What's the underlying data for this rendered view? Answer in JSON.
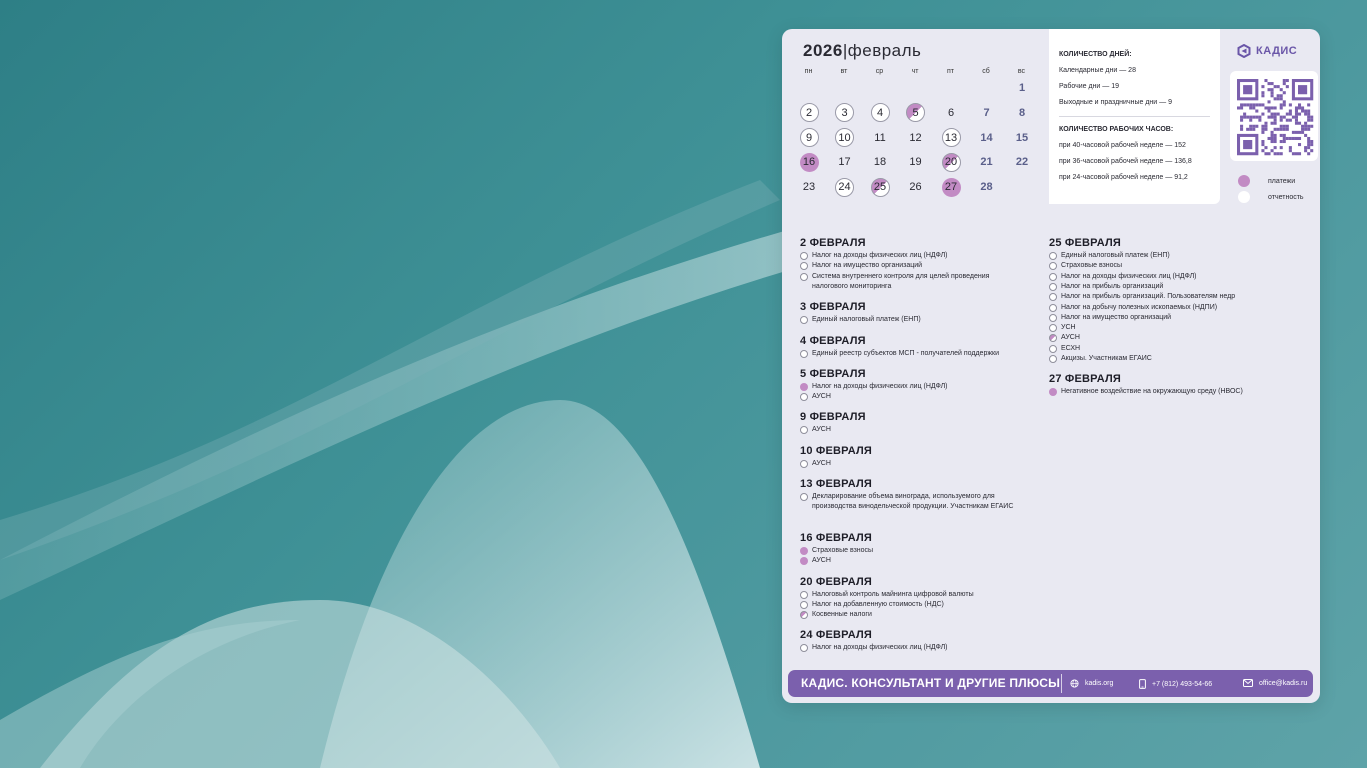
{
  "calendar": {
    "year": "2026",
    "separator": "|",
    "month": "февраль",
    "weekdays": [
      "пн",
      "вт",
      "ср",
      "чт",
      "пт",
      "сб",
      "вс"
    ],
    "days": [
      {
        "d": "1",
        "col": 6,
        "row": 0,
        "kind": "plain",
        "weekend": true
      },
      {
        "d": "2",
        "col": 0,
        "row": 1,
        "kind": "rep"
      },
      {
        "d": "3",
        "col": 1,
        "row": 1,
        "kind": "rep"
      },
      {
        "d": "4",
        "col": 2,
        "row": 1,
        "kind": "rep"
      },
      {
        "d": "5",
        "col": 3,
        "row": 1,
        "kind": "half"
      },
      {
        "d": "6",
        "col": 4,
        "row": 1,
        "kind": "plain"
      },
      {
        "d": "7",
        "col": 5,
        "row": 1,
        "kind": "plain",
        "weekend": true
      },
      {
        "d": "8",
        "col": 6,
        "row": 1,
        "kind": "plain",
        "weekend": true
      },
      {
        "d": "9",
        "col": 0,
        "row": 2,
        "kind": "rep"
      },
      {
        "d": "10",
        "col": 1,
        "row": 2,
        "kind": "rep"
      },
      {
        "d": "11",
        "col": 2,
        "row": 2,
        "kind": "plain"
      },
      {
        "d": "12",
        "col": 3,
        "row": 2,
        "kind": "plain"
      },
      {
        "d": "13",
        "col": 4,
        "row": 2,
        "kind": "rep"
      },
      {
        "d": "14",
        "col": 5,
        "row": 2,
        "kind": "plain",
        "weekend": true
      },
      {
        "d": "15",
        "col": 6,
        "row": 2,
        "kind": "plain",
        "weekend": true
      },
      {
        "d": "16",
        "col": 0,
        "row": 3,
        "kind": "pay"
      },
      {
        "d": "17",
        "col": 1,
        "row": 3,
        "kind": "plain"
      },
      {
        "d": "18",
        "col": 2,
        "row": 3,
        "kind": "plain"
      },
      {
        "d": "19",
        "col": 3,
        "row": 3,
        "kind": "plain"
      },
      {
        "d": "20",
        "col": 4,
        "row": 3,
        "kind": "half"
      },
      {
        "d": "21",
        "col": 5,
        "row": 3,
        "kind": "plain",
        "weekend": true
      },
      {
        "d": "22",
        "col": 6,
        "row": 3,
        "kind": "plain",
        "weekend": true
      },
      {
        "d": "23",
        "col": 0,
        "row": 4,
        "kind": "plain"
      },
      {
        "d": "24",
        "col": 1,
        "row": 4,
        "kind": "rep"
      },
      {
        "d": "25",
        "col": 2,
        "row": 4,
        "kind": "half"
      },
      {
        "d": "26",
        "col": 3,
        "row": 4,
        "kind": "plain"
      },
      {
        "d": "27",
        "col": 4,
        "row": 4,
        "kind": "pay"
      },
      {
        "d": "28",
        "col": 5,
        "row": 4,
        "kind": "plain",
        "weekend": true
      }
    ]
  },
  "stats": {
    "days_title": "КОЛИЧЕСТВО ДНЕЙ:",
    "calendar_days": "Календарные дни — 28",
    "work_days": "Рабочие дни — 19",
    "holidays": "Выходные и праздничные дни — 9",
    "hours_title": "КОЛИЧЕСТВО РАБОЧИХ ЧАСОВ:",
    "h40": "при 40-часовой рабочей неделе — 152",
    "h36": "при 36-часовой рабочей неделе — 136,8",
    "h24": "при 24-часовой рабочей неделе — 91,2"
  },
  "brand": {
    "logo_text": "КАДИС"
  },
  "legend": {
    "payments": "платежи",
    "reporting": "отчетность"
  },
  "events_left": [
    {
      "date": "2 ФЕВРАЛЯ",
      "items": [
        {
          "text": "Налог на доходы физических лиц (НДФЛ)",
          "kind": "rep"
        },
        {
          "text": "Налог на имущество организаций",
          "kind": "rep"
        },
        {
          "text": "Система внутреннего контроля для целей проведения налогового мониторинга",
          "kind": "rep",
          "lines": 2
        }
      ]
    },
    {
      "date": "3 ФЕВРАЛЯ",
      "items": [
        {
          "text": "Единый налоговый платеж (ЕНП)",
          "kind": "rep"
        }
      ]
    },
    {
      "date": "4 ФЕВРАЛЯ",
      "items": [
        {
          "text": "Единый реестр субъектов МСП - получателей поддержки",
          "kind": "rep"
        }
      ]
    },
    {
      "date": "5 ФЕВРАЛЯ",
      "items": [
        {
          "text": "Налог на доходы физических лиц (НДФЛ)",
          "kind": "pay"
        },
        {
          "text": "АУСН",
          "kind": "rep"
        }
      ]
    },
    {
      "date": "9 ФЕВРАЛЯ",
      "items": [
        {
          "text": "АУСН",
          "kind": "rep"
        }
      ]
    },
    {
      "date": "10 ФЕВРАЛЯ",
      "items": [
        {
          "text": "АУСН",
          "kind": "rep"
        }
      ]
    },
    {
      "date": "13 ФЕВРАЛЯ",
      "items": [
        {
          "text": "Декларирование объема винограда, используемого для производства винодельческой продукции. Участникам ЕГАИС",
          "kind": "rep",
          "lines": 3
        }
      ]
    },
    {
      "date": "16 ФЕВРАЛЯ",
      "items": [
        {
          "text": "Страховые взносы",
          "kind": "pay"
        },
        {
          "text": "АУСН",
          "kind": "pay"
        }
      ]
    },
    {
      "date": "20 ФЕВРАЛЯ",
      "items": [
        {
          "text": "Налоговый контроль майнинга цифровой валюты",
          "kind": "rep"
        },
        {
          "text": "Налог на добавленную стоимость (НДС)",
          "kind": "rep"
        },
        {
          "text": "Косвенные налоги",
          "kind": "half"
        }
      ]
    },
    {
      "date": "24 ФЕВРАЛЯ",
      "items": [
        {
          "text": "Налог на доходы физических лиц (НДФЛ)",
          "kind": "rep"
        }
      ]
    }
  ],
  "events_right": [
    {
      "date": "25 ФЕВРАЛЯ",
      "items": [
        {
          "text": "Единый налоговый платеж (ЕНП)",
          "kind": "rep"
        },
        {
          "text": "Страховые взносы",
          "kind": "rep"
        },
        {
          "text": "Налог на доходы физических лиц (НДФЛ)",
          "kind": "rep"
        },
        {
          "text": "Налог на прибыль организаций",
          "kind": "rep"
        },
        {
          "text": "Налог на прибыль организаций. Пользователям недр",
          "kind": "rep"
        },
        {
          "text": "Налог на добычу полезных ископаемых (НДПИ)",
          "kind": "rep"
        },
        {
          "text": "Налог на имущество организаций",
          "kind": "rep"
        },
        {
          "text": "УСН",
          "kind": "rep"
        },
        {
          "text": "АУСН",
          "kind": "half"
        },
        {
          "text": "ЕСХН",
          "kind": "rep"
        },
        {
          "text": "Акцизы. Участникам ЕГАИС",
          "kind": "rep"
        }
      ]
    },
    {
      "date": "27 ФЕВРАЛЯ",
      "items": [
        {
          "text": "Негативное воздействие на окружающую среду (НВОС)",
          "kind": "pay"
        }
      ]
    }
  ],
  "footer": {
    "brand": "КАДИС. КОНСУЛЬТАНТ И ДРУГИЕ ПЛЮСЫ",
    "site": "kadis.org",
    "phone": "+7 (812) 493-54-66",
    "email": "office@kadis.ru"
  },
  "colors": {
    "accent": "#7b60ad",
    "payment": "#c28bc4",
    "card": "#e9e9f2"
  }
}
